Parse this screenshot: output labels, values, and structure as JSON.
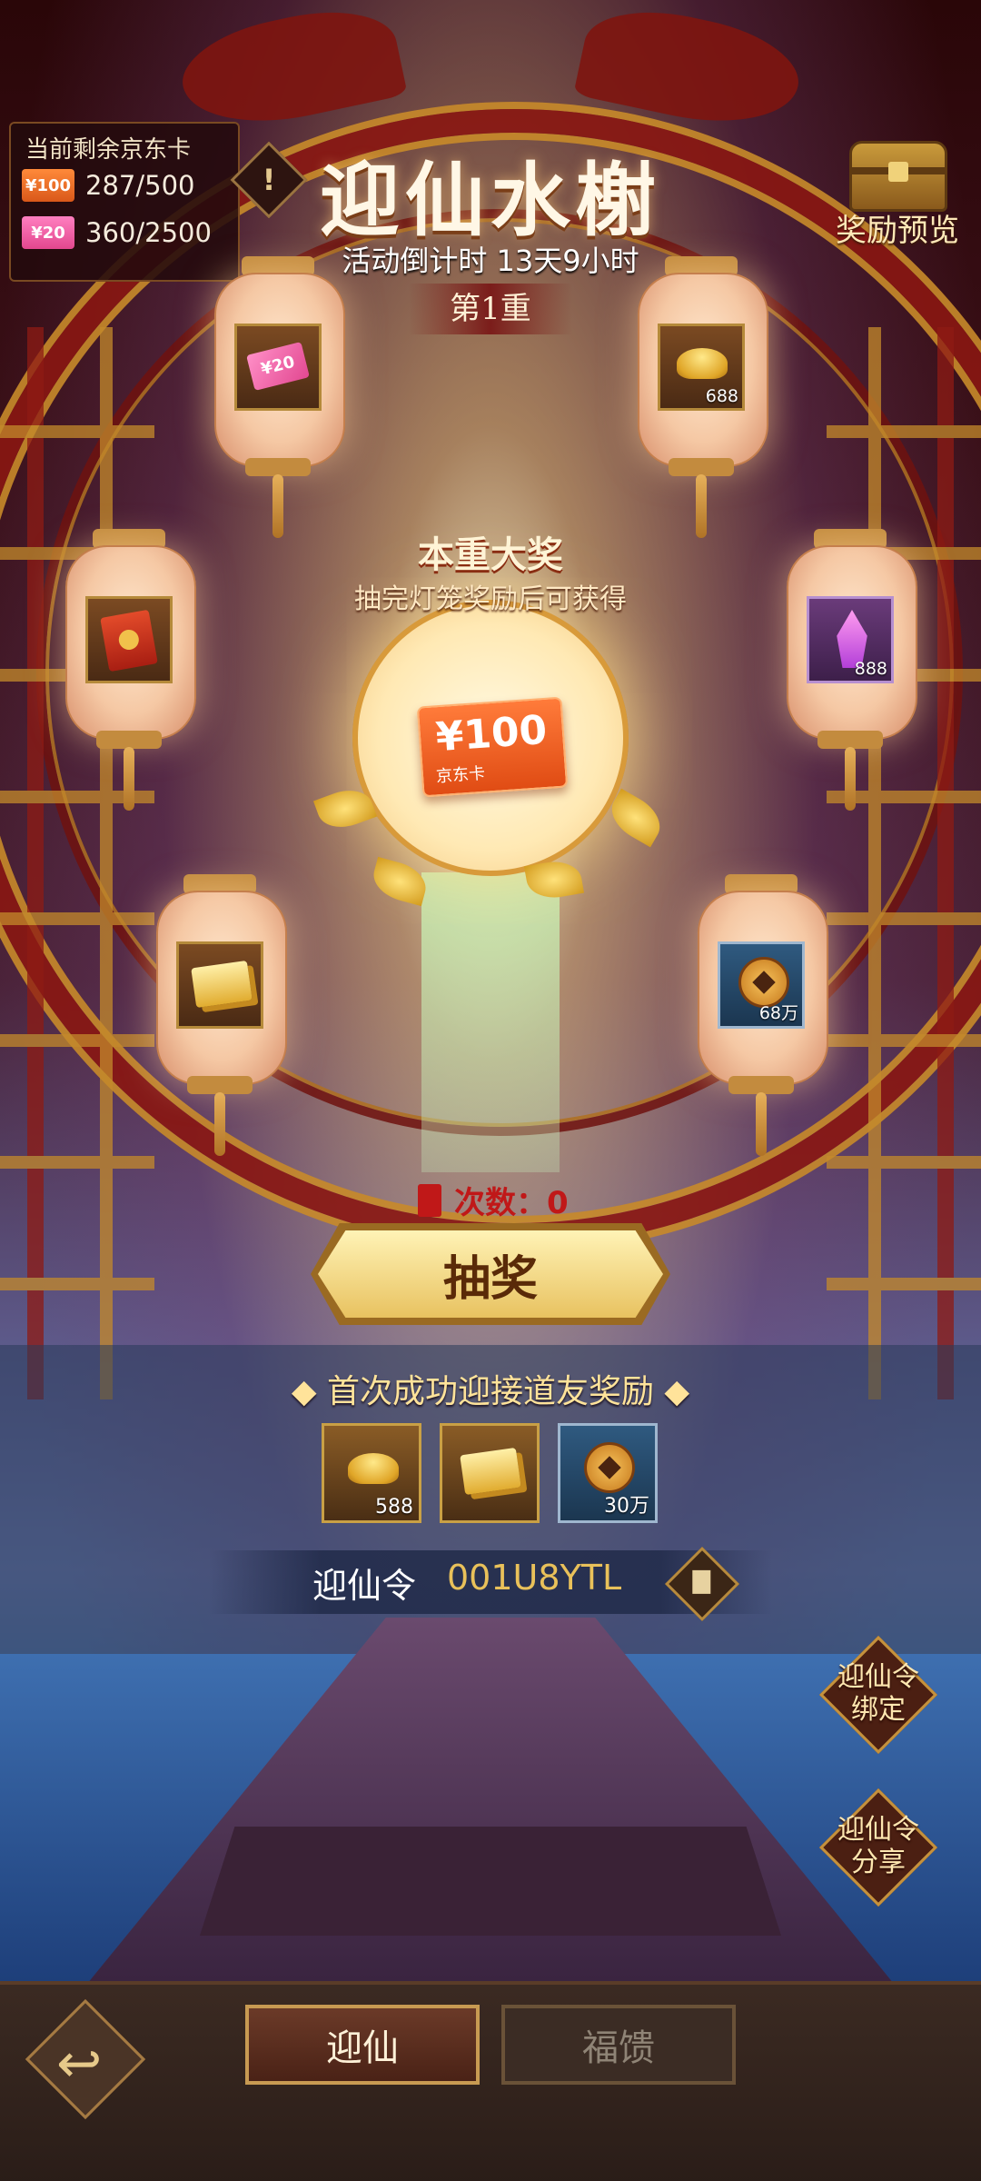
{
  "counter": {
    "title": "当前剩余京东卡",
    "rows": [
      {
        "badge": "¥100",
        "value": "287/500"
      },
      {
        "badge": "¥20",
        "value": "360/2500"
      }
    ]
  },
  "header": {
    "title": "迎仙水榭",
    "countdown": "活动倒计时 13天9小时",
    "stage": "第1重",
    "info_icon": "!",
    "preview_label": "奖励预览"
  },
  "lanterns": [
    {
      "icon": "jd-card-20-icon",
      "label": "¥20",
      "count": ""
    },
    {
      "icon": "gold-ingot-icon",
      "count": "688"
    },
    {
      "icon": "red-envelope-icon",
      "count": ""
    },
    {
      "icon": "purple-crystal-icon",
      "count": "888"
    },
    {
      "icon": "gold-ticket-icon",
      "count": ""
    },
    {
      "icon": "copper-coin-icon",
      "count": "68万"
    }
  ],
  "grand_prize": {
    "title": "本重大奖",
    "subtitle": "抽完灯笼奖励后可获得",
    "card_value": "¥100",
    "card_sub": "京东卡"
  },
  "draw": {
    "tries_label": "次数：0",
    "button_label": "抽奖"
  },
  "first_reward": {
    "title": "◆ 首次成功迎接道友奖励 ◆",
    "items": [
      {
        "icon": "gold-ingot-icon",
        "count": "588"
      },
      {
        "icon": "gold-ticket-icon",
        "count": ""
      },
      {
        "icon": "copper-coin-icon",
        "count": "30万"
      }
    ]
  },
  "invite_code": {
    "label": "迎仙令",
    "value": "001U8YTL"
  },
  "side_buttons": {
    "bind_line1": "迎仙令",
    "bind_line2": "绑定",
    "share_line1": "迎仙令",
    "share_line2": "分享"
  },
  "bottom_tabs": {
    "back": "↩",
    "tab1": "迎仙",
    "tab2": "福馈"
  },
  "colors": {
    "title_text": "#fff7e6",
    "tries_red": "#c01818",
    "code_gold": "#e9c15a"
  }
}
